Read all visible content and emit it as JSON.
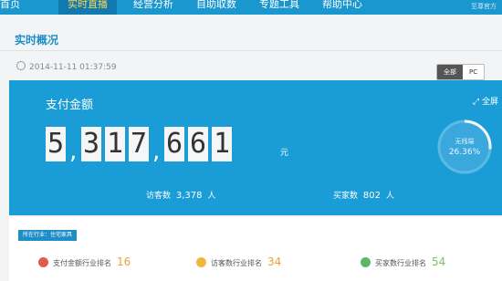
{
  "nav": {
    "items": [
      "首页",
      "实时直播",
      "经营分析",
      "自助取数",
      "专题工具",
      "帮助中心"
    ],
    "right_text": "至尊官方"
  },
  "page": {
    "title": "实时概况",
    "timestamp": "2014-11-11 01:37:59"
  },
  "toggle": {
    "all": "全部",
    "pc": "PC"
  },
  "panel": {
    "label": "支付金额",
    "fullscreen": "全屏",
    "digits": [
      "5",
      "3",
      "1",
      "7",
      "6",
      "6",
      "1"
    ],
    "unit": "元",
    "visitors_label": "访客数",
    "visitors_value": "3,378",
    "visitors_unit": "人",
    "buyers_label": "买家数",
    "buyers_value": "802",
    "buyers_unit": "人",
    "gauge_label": "无线端",
    "gauge_value": "26.36%",
    "gauge_fraction": 0.2636
  },
  "ranks": {
    "industry_tag": "所在行业：住宅家具",
    "pay": {
      "label": "支付金额行业排名",
      "value": "16"
    },
    "visitors": {
      "label": "访客数行业排名",
      "value": "34"
    },
    "buyers": {
      "label": "买家数行业排名",
      "value": "54"
    }
  },
  "colors": {
    "nav": "#1b97cf",
    "panel": "#1a9dd6",
    "accent": "#ffd54a",
    "rank_number": "#e8a33b"
  }
}
